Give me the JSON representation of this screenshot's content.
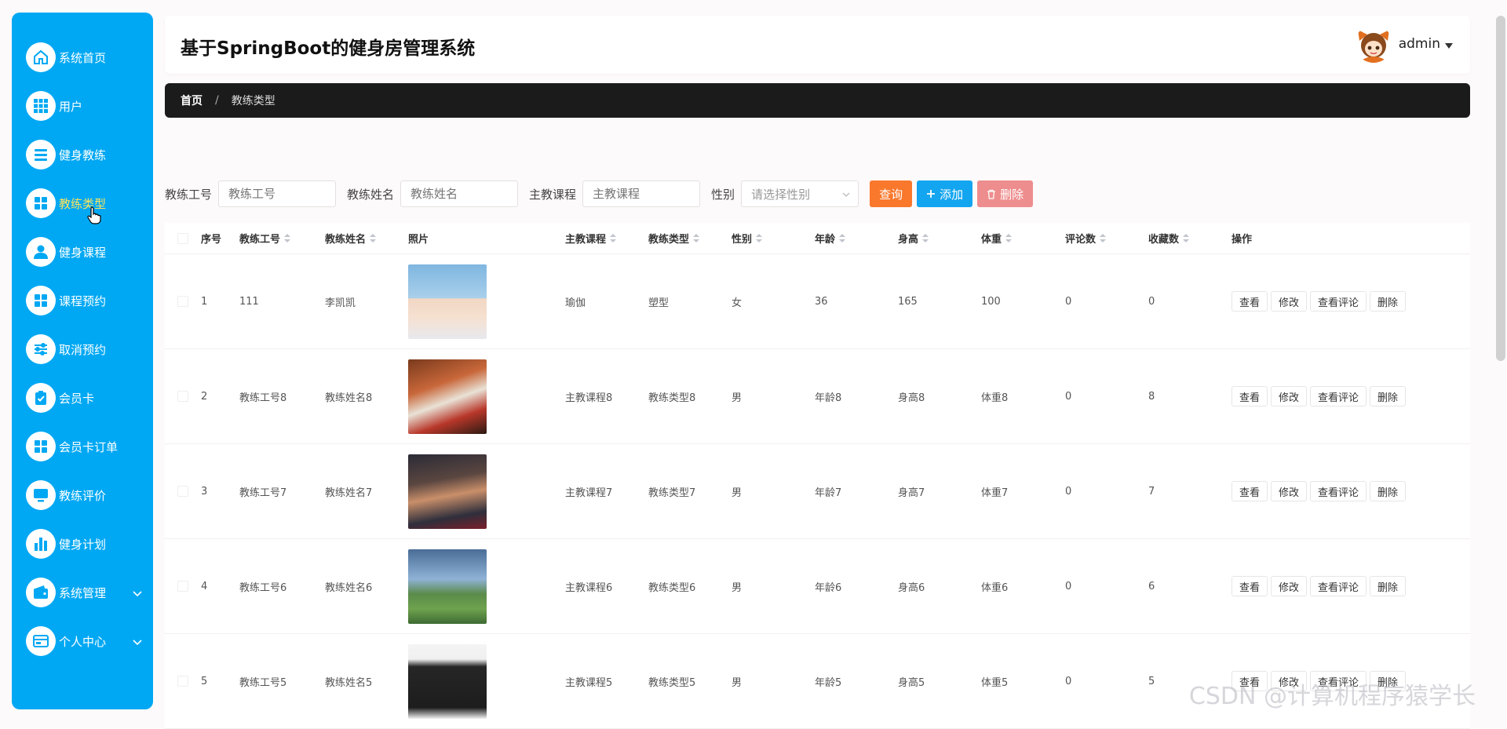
{
  "sidebar": {
    "items": [
      {
        "label": "系统首页",
        "icon": "home-icon"
      },
      {
        "label": "用户",
        "icon": "grid-icon"
      },
      {
        "label": "健身教练",
        "icon": "list-icon"
      },
      {
        "label": "教练类型",
        "icon": "apps-icon"
      },
      {
        "label": "健身课程",
        "icon": "user-icon"
      },
      {
        "label": "课程预约",
        "icon": "apps-icon"
      },
      {
        "label": "取消预约",
        "icon": "sliders-icon"
      },
      {
        "label": "会员卡",
        "icon": "clipboard-icon"
      },
      {
        "label": "会员卡订单",
        "icon": "apps-icon"
      },
      {
        "label": "教练评价",
        "icon": "monitor-icon"
      },
      {
        "label": "健身计划",
        "icon": "bar-chart-icon"
      },
      {
        "label": "系统管理",
        "icon": "wallet-icon"
      },
      {
        "label": "个人中心",
        "icon": "card-icon"
      }
    ],
    "active_index": 3
  },
  "header": {
    "title": "基于SpringBoot的健身房管理系统",
    "user_name": "admin"
  },
  "breadcrumb": {
    "home": "首页",
    "separator": "/",
    "current": "教练类型"
  },
  "search": {
    "coach_no_label": "教练工号",
    "coach_no_placeholder": "教练工号",
    "coach_name_label": "教练姓名",
    "coach_name_placeholder": "教练姓名",
    "course_label": "主教课程",
    "course_placeholder": "主教课程",
    "gender_label": "性别",
    "gender_placeholder": "请选择性别",
    "query_button": "查询",
    "add_button": "添加",
    "delete_button": "删除"
  },
  "table": {
    "headers": [
      "序号",
      "教练工号",
      "教练姓名",
      "照片",
      "主教课程",
      "教练类型",
      "性别",
      "年龄",
      "身高",
      "体重",
      "评论数",
      "收藏数",
      "操作"
    ],
    "op_labels": [
      "查看",
      "修改",
      "查看评论",
      "删除"
    ],
    "rows": [
      {
        "index": "1",
        "coach_no": "111",
        "name": "李凯凯",
        "course": "瑜伽",
        "type": "塑型",
        "gender": "女",
        "age": "36",
        "height": "165",
        "weight": "100",
        "comments": "0",
        "favorites": "0"
      },
      {
        "index": "2",
        "coach_no": "教练工号8",
        "name": "教练姓名8",
        "course": "主教课程8",
        "type": "教练类型8",
        "gender": "男",
        "age": "年龄8",
        "height": "身高8",
        "weight": "体重8",
        "comments": "0",
        "favorites": "8"
      },
      {
        "index": "3",
        "coach_no": "教练工号7",
        "name": "教练姓名7",
        "course": "主教课程7",
        "type": "教练类型7",
        "gender": "男",
        "age": "年龄7",
        "height": "身高7",
        "weight": "体重7",
        "comments": "0",
        "favorites": "7"
      },
      {
        "index": "4",
        "coach_no": "教练工号6",
        "name": "教练姓名6",
        "course": "主教课程6",
        "type": "教练类型6",
        "gender": "男",
        "age": "年龄6",
        "height": "身高6",
        "weight": "体重6",
        "comments": "0",
        "favorites": "6"
      },
      {
        "index": "5",
        "coach_no": "教练工号5",
        "name": "教练姓名5",
        "course": "主教课程5",
        "type": "教练类型5",
        "gender": "男",
        "age": "年龄5",
        "height": "身高5",
        "weight": "体重5",
        "comments": "0",
        "favorites": "5"
      }
    ]
  },
  "watermark": "CSDN @计算机程序猿学长",
  "colors": {
    "sidebar_bg": "#00a8f3",
    "active_label": "#ffe45c",
    "query_btn": "#f9782c",
    "add_btn": "#13a5ef",
    "delete_btn": "#ee8d8d"
  }
}
